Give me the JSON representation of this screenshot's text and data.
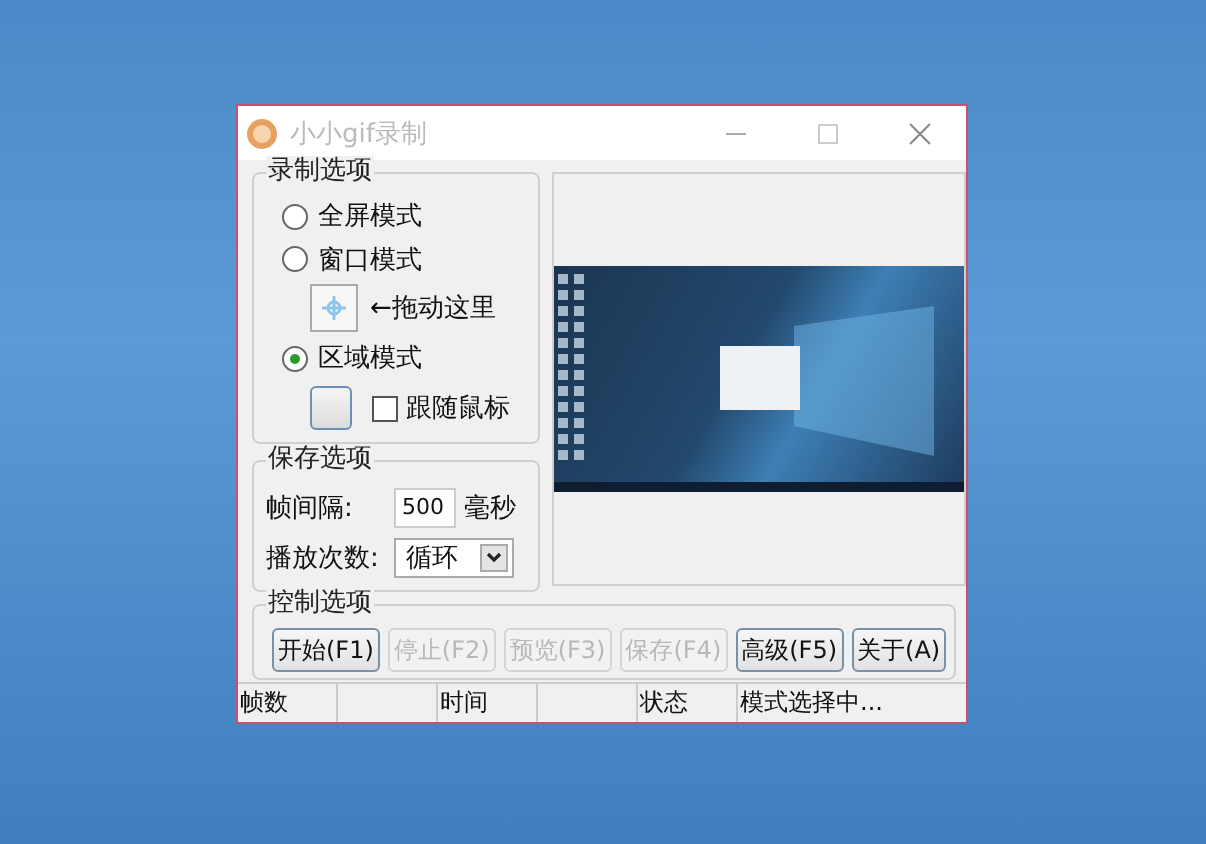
{
  "window": {
    "title": "小小gif录制"
  },
  "record_options": {
    "title": "录制选项",
    "modes": [
      {
        "kind": "plain",
        "label": "全屏模式",
        "selected": false
      },
      {
        "kind": "drag",
        "label": "窗口模式",
        "selected": false,
        "hint": "←拖动这里"
      },
      {
        "kind": "region",
        "label": "区域模式",
        "selected": true,
        "follow_label": "跟随鼠标",
        "follow_checked": false
      }
    ]
  },
  "save_options": {
    "title": "保存选项",
    "interval_label": "帧间隔:",
    "interval_value": "500",
    "interval_unit": "毫秒",
    "repeat_label": "播放次数:",
    "repeat_value": "循环"
  },
  "control_options": {
    "title": "控制选项",
    "buttons": [
      {
        "label": "开始(F1)",
        "disabled": false
      },
      {
        "label": "停止(F2)",
        "disabled": true
      },
      {
        "label": "预览(F3)",
        "disabled": true
      },
      {
        "label": "保存(F4)",
        "disabled": true
      },
      {
        "label": "高级(F5)",
        "disabled": false
      },
      {
        "label": "关于(A)",
        "disabled": false
      }
    ]
  },
  "status_bar": [
    {
      "label": "帧数"
    },
    {
      "label": "时间"
    },
    {
      "label": "状态",
      "value": "模式选择中..."
    }
  ]
}
